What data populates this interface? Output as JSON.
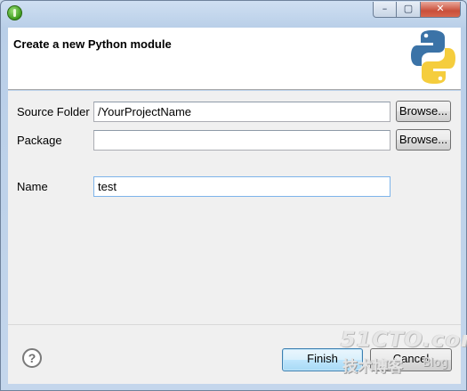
{
  "window": {
    "title": "",
    "controls": {
      "minimize_glyph": "–",
      "maximize_glyph": "▢",
      "close_glyph": "✕"
    },
    "app_icon": "eclipse-icon"
  },
  "header": {
    "title": "Create a new Python module",
    "logo": "python-logo"
  },
  "form": {
    "source_folder": {
      "label": "Source Folder",
      "value": "/YourProjectName",
      "browse_label": "Browse..."
    },
    "package": {
      "label": "Package",
      "value": "",
      "browse_label": "Browse..."
    },
    "name": {
      "label": "Name",
      "value": "test"
    }
  },
  "footer": {
    "help_icon": "help-icon",
    "help_glyph": "?",
    "finish_label": "Finish",
    "cancel_label": "Cancel"
  },
  "watermark": {
    "main": "51CTO.com",
    "sub": "技术博客",
    "blog": "Blog"
  },
  "colors": {
    "python_blue": "#3b73a7",
    "python_yellow": "#f5cd3d",
    "accent_border": "#3c7fb1"
  }
}
